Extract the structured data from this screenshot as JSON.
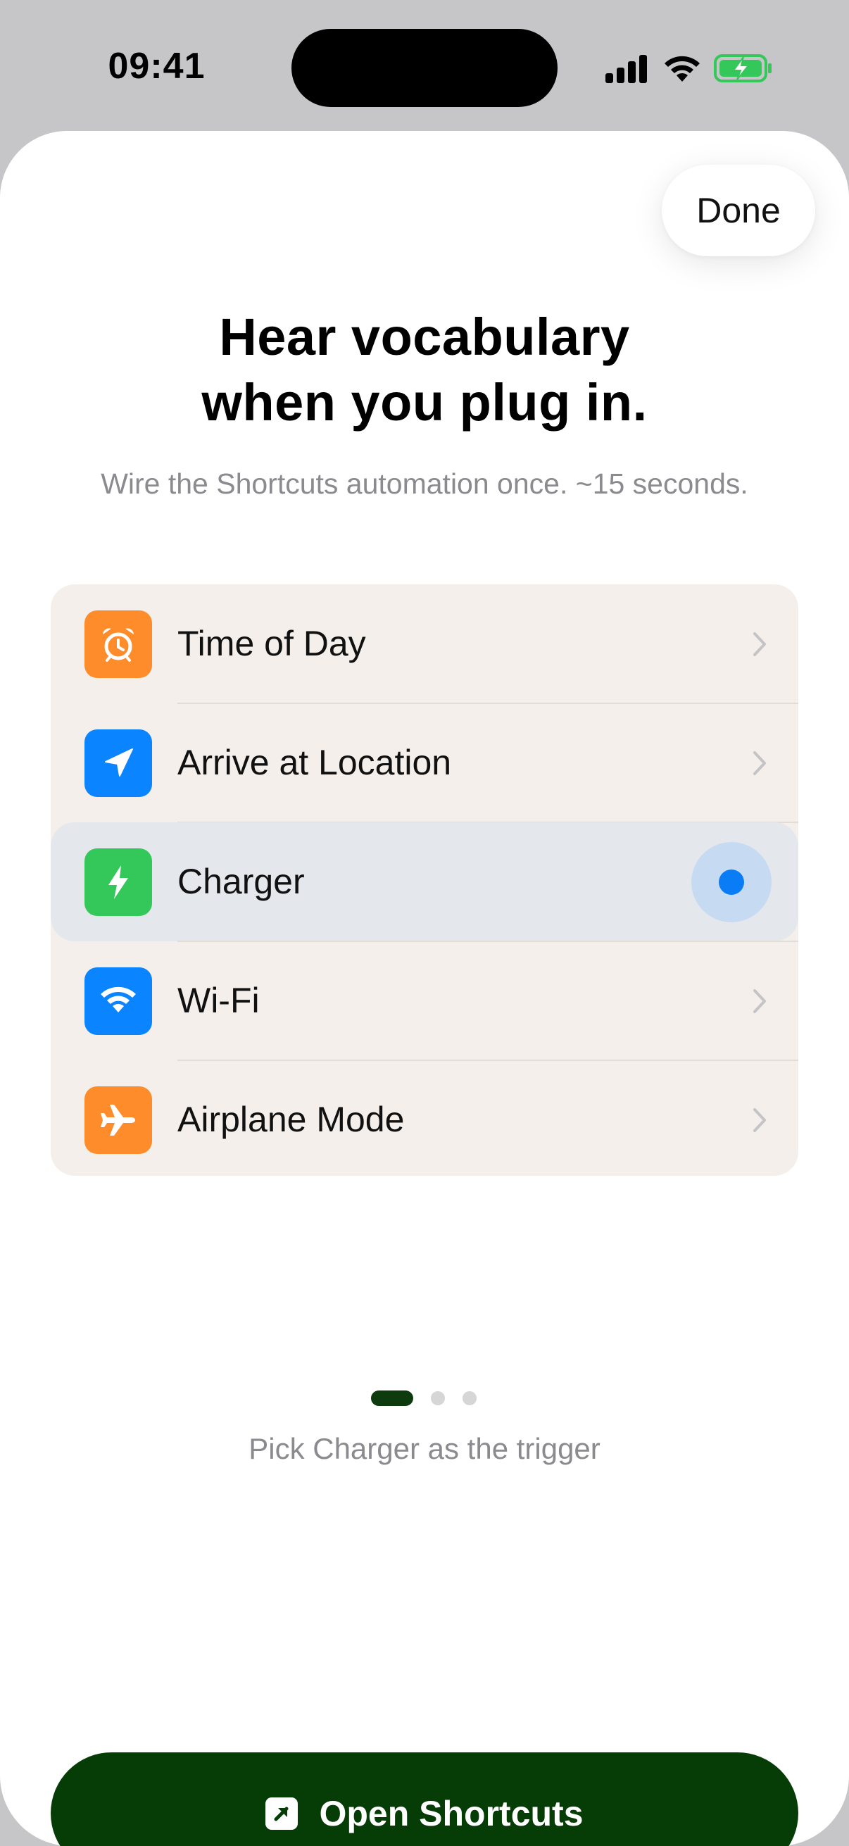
{
  "status_bar": {
    "time": "09:41",
    "icons": [
      "cellular-signal-icon",
      "wifi-icon",
      "battery-charging-icon"
    ],
    "battery_color": "#34c759"
  },
  "sheet": {
    "done_label": "Done",
    "title_line_1": "Hear vocabulary",
    "title_line_2": "when you plug in.",
    "subtitle": "Wire the Shortcuts automation once. ~15 seconds.",
    "triggers": [
      {
        "label": "Time of Day",
        "icon": "alarm-clock-icon",
        "color": "#ff8c2a",
        "selected": false
      },
      {
        "label": "Arrive at Location",
        "icon": "location-arrow-icon",
        "color": "#0a84ff",
        "selected": false
      },
      {
        "label": "Charger",
        "icon": "bolt-icon",
        "color": "#34c759",
        "selected": true
      },
      {
        "label": "Wi-Fi",
        "icon": "wifi-icon",
        "color": "#0a84ff",
        "selected": false
      },
      {
        "label": "Airplane Mode",
        "icon": "airplane-icon",
        "color": "#ff8c2a",
        "selected": false
      }
    ],
    "pagination": {
      "total": 3,
      "current": 1
    },
    "step_caption": "Pick Charger as the trigger",
    "primary_button_label": "Open Shortcuts",
    "primary_button_icon": "open-external-icon",
    "accent_color": "#063d06"
  }
}
